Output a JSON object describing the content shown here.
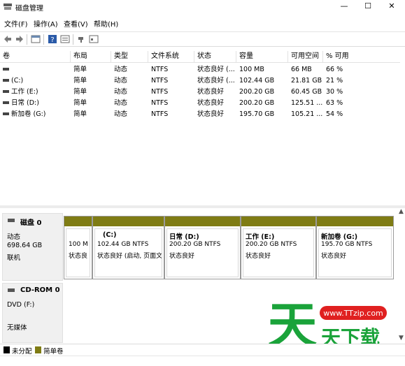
{
  "window": {
    "title": "磁盘管理",
    "buttons": {
      "minimize": "—",
      "maximize": "☐",
      "close": "✕"
    }
  },
  "menu": [
    {
      "label": "文件(F)"
    },
    {
      "label": "操作(A)"
    },
    {
      "label": "查看(V)"
    },
    {
      "label": "帮助(H)"
    }
  ],
  "toolbar": {
    "icons": [
      "back-arrow-icon",
      "forward-arrow-icon",
      "properties-icon",
      "help-icon",
      "view-icon",
      "connect-icon",
      "list-icon"
    ]
  },
  "volume_table": {
    "columns": [
      "卷",
      "布局",
      "类型",
      "文件系统",
      "状态",
      "容量",
      "可用空间",
      "% 可用"
    ],
    "rows": [
      {
        "volume": "",
        "layout": "简单",
        "type": "动态",
        "fs": "NTFS",
        "status": "状态良好 (...",
        "capacity": "100 MB",
        "free": "66 MB",
        "pct": "66 %"
      },
      {
        "volume": "(C:)",
        "layout": "简单",
        "type": "动态",
        "fs": "NTFS",
        "status": "状态良好 (...",
        "capacity": "102.44 GB",
        "free": "21.81 GB",
        "pct": "21 %"
      },
      {
        "volume": "工作 (E:)",
        "layout": "简单",
        "type": "动态",
        "fs": "NTFS",
        "status": "状态良好",
        "capacity": "200.20 GB",
        "free": "60.45 GB",
        "pct": "30 %"
      },
      {
        "volume": "日常 (D:)",
        "layout": "简单",
        "type": "动态",
        "fs": "NTFS",
        "status": "状态良好",
        "capacity": "200.20 GB",
        "free": "125.51 ...",
        "pct": "63 %"
      },
      {
        "volume": "新加卷 (G:)",
        "layout": "简单",
        "type": "动态",
        "fs": "NTFS",
        "status": "状态良好",
        "capacity": "195.70 GB",
        "free": "105.21 ...",
        "pct": "54 %"
      }
    ]
  },
  "disks": [
    {
      "name": "磁盘 0",
      "type": "动态",
      "size": "698.64 GB",
      "state": "联机",
      "partitions": [
        {
          "name": "",
          "line1": "100 M",
          "line2": "状态良"
        },
        {
          "name": "(C:)",
          "line1": "102.44 GB NTFS",
          "line2": "状态良好 (启动, 页面文"
        },
        {
          "name": "日常  (D:)",
          "line1": "200.20 GB NTFS",
          "line2": "状态良好"
        },
        {
          "name": "工作  (E:)",
          "line1": "200.20 GB NTFS",
          "line2": "状态良好"
        },
        {
          "name": "新加卷  (G:)",
          "line1": "195.70 GB NTFS",
          "line2": "状态良好"
        }
      ]
    },
    {
      "name": "CD-ROM 0",
      "type": "DVD (F:)",
      "size": "",
      "state": "无媒体",
      "partitions": []
    }
  ],
  "legend": [
    {
      "label": "未分配",
      "color": "#000000"
    },
    {
      "label": "简单卷",
      "color": "#7f7c14"
    }
  ],
  "watermark": {
    "glyph": "天",
    "url": "www.TTzip.com",
    "name": "天下载",
    "color": "#1aa33a",
    "badge_color": "#e02020"
  }
}
